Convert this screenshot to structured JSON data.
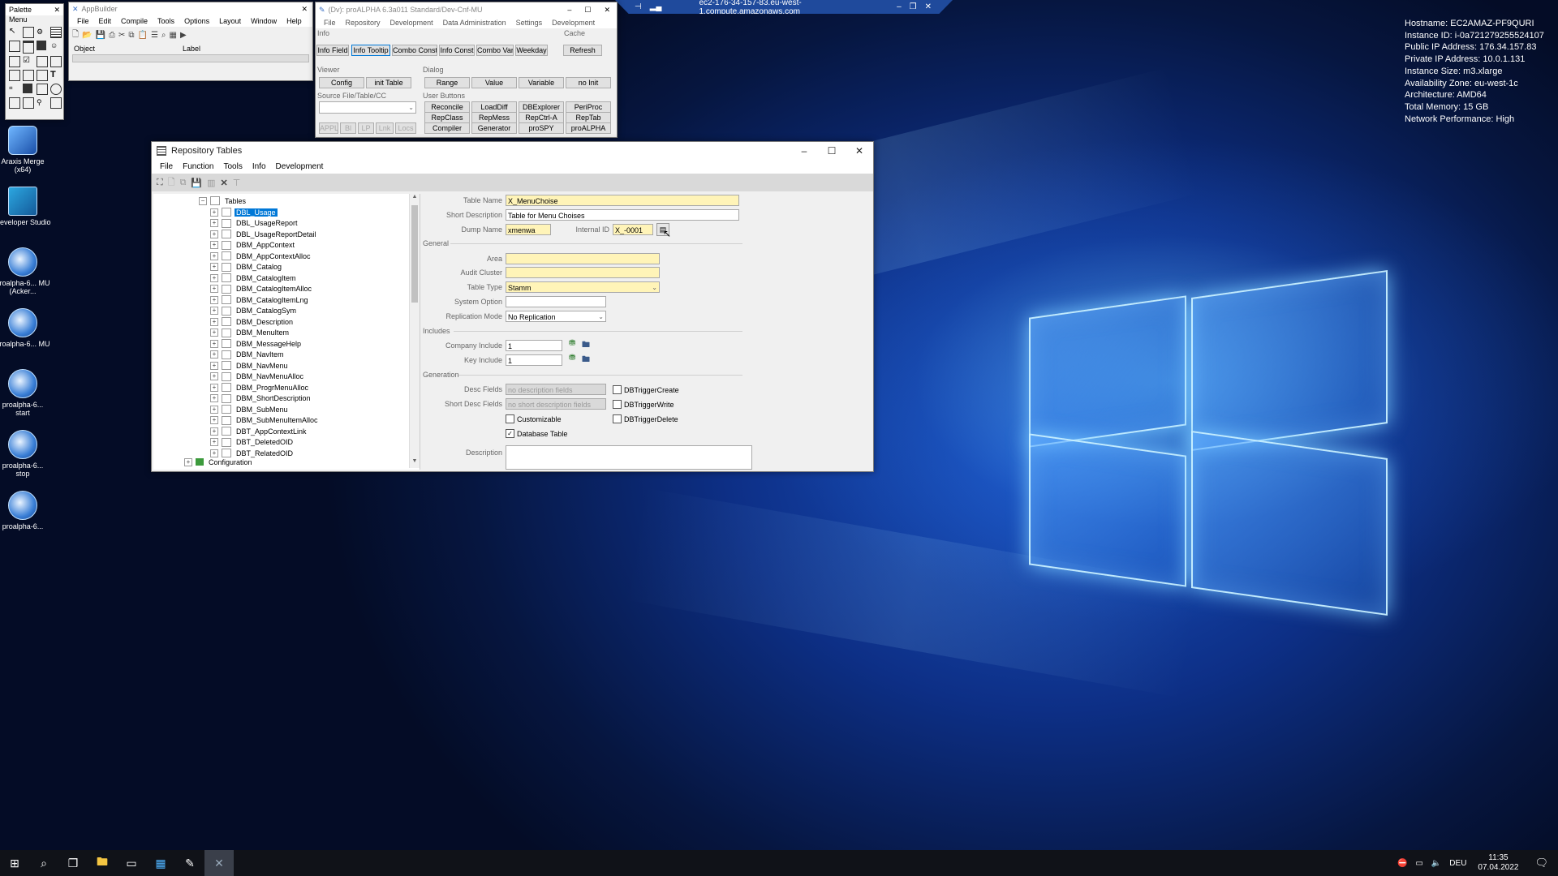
{
  "sysinfo": {
    "hostname": "Hostname: EC2AMAZ-PF9QURI",
    "instance_id": "Instance ID: i-0a721279255524107",
    "public_ip": "Public IP Address: 176.34.157.83",
    "private_ip": "Private IP Address: 10.0.1.131",
    "instance_size": "Instance Size: m3.xlarge",
    "availability_zone": "Availability Zone: eu-west-1c",
    "architecture": "Architecture: AMD64",
    "total_memory": "Total Memory: 15 GB",
    "network": "Network Performance: High"
  },
  "remote_bar": {
    "title": "ec2-176-34-157-83.eu-west-1.compute.amazonaws.com"
  },
  "desktop_icons": [
    {
      "label": "Araxis Merge (x64)"
    },
    {
      "label": "Developer Studio"
    },
    {
      "label": "proalpha-6... MU (Acker..."
    },
    {
      "label": "proalpha-6... MU"
    },
    {
      "label": "proalpha-6... start"
    },
    {
      "label": "proalpha-6... stop"
    },
    {
      "label": "proalpha-6..."
    }
  ],
  "palette": {
    "title": "Palette",
    "subtitle": "Menu"
  },
  "appbuilder": {
    "title": "AppBuilder",
    "menu": [
      "File",
      "Edit",
      "Compile",
      "Tools",
      "Options",
      "Layout",
      "Window",
      "Help"
    ],
    "object_label": "Object",
    "label_label": "Label"
  },
  "proalpha": {
    "title": "(Dv): proALPHA 6.3a011 Standard/Dev-Cnf-MU",
    "menu": [
      "File",
      "Repository",
      "Development",
      "Data Administration",
      "Settings",
      "Development"
    ],
    "info_group": "Info",
    "cache_group": "Cache",
    "info_buttons": [
      "Info Field",
      "Info Tooltip",
      "Combo Const",
      "Info Const",
      "Combo Var",
      "Weekday"
    ],
    "refresh": "Refresh",
    "viewer_group": "Viewer",
    "dialog_group": "Dialog",
    "viewer_buttons": [
      "Config",
      "init Table"
    ],
    "dialog_buttons": [
      "Range",
      "Value",
      "Variable",
      "no Init"
    ],
    "source_group": "Source File/Table/CC",
    "user_buttons_group": "User Buttons",
    "source_buttons": [
      "APPL",
      "Bl",
      "LP",
      "Lnk",
      "Locs"
    ],
    "user_buttons": [
      "Reconcile",
      "LoadDiff",
      "DBExplorer",
      "PeriProc",
      "RepClass",
      "RepMess",
      "RepCtrl-A",
      "RepTab",
      "Compiler",
      "Generator",
      "proSPY",
      "proALPHA"
    ]
  },
  "repo": {
    "title": "Repository Tables",
    "menu": [
      "File",
      "Function",
      "Tools",
      "Info",
      "Development"
    ],
    "tree": {
      "root": "Tables",
      "items": [
        "DBL_Usage",
        "DBL_UsageReport",
        "DBL_UsageReportDetail",
        "DBM_AppContext",
        "DBM_AppContextAlloc",
        "DBM_Catalog",
        "DBM_CatalogItem",
        "DBM_CatalogItemAlloc",
        "DBM_CatalogItemLng",
        "DBM_CatalogSym",
        "DBM_Description",
        "DBM_MenuItem",
        "DBM_MessageHelp",
        "DBM_NavItem",
        "DBM_NavMenu",
        "DBM_NavMenuAlloc",
        "DBM_ProgrMenuAlloc",
        "DBM_ShortDescription",
        "DBM_SubMenu",
        "DBM_SubMenuItemAlloc",
        "DBT_AppContextLink",
        "DBT_DeletedOID",
        "DBT_RelatedOID"
      ],
      "configuration": "Configuration"
    },
    "form": {
      "table_name_label": "Table Name",
      "table_name": "X_MenuChoise",
      "short_desc_label": "Short Description",
      "short_desc": "Table for Menu Choises",
      "dump_name_label": "Dump Name",
      "dump_name": "xmenwa",
      "internal_id_label": "Internal ID",
      "internal_id": "X_-0001",
      "general_group": "General",
      "area_label": "Area",
      "audit_cluster_label": "Audit Cluster",
      "table_type_label": "Table Type",
      "table_type": "Stamm",
      "system_option_label": "System Option",
      "replication_label": "Replication Mode",
      "replication": "No Replication",
      "includes_group": "Includes",
      "company_include_label": "Company Include",
      "company_include": "1",
      "key_include_label": "Key Include",
      "key_include": "1",
      "generation_group": "Generation",
      "desc_fields_label": "Desc Fields",
      "desc_fields": "no description fields",
      "short_desc_fields_label": "Short Desc Fields",
      "short_desc_fields": "no short description fields",
      "customizable": "Customizable",
      "database_table": "Database Table",
      "trigger_create": "DBTriggerCreate",
      "trigger_write": "DBTriggerWrite",
      "trigger_delete": "DBTriggerDelete",
      "description_label": "Description"
    }
  },
  "tray": {
    "lang": "DEU",
    "time": "11:35",
    "date": "07.04.2022"
  },
  "colors": {
    "accent": "#0078d7",
    "field_yellow": "#fff4b8",
    "taskbar": "#101218"
  }
}
